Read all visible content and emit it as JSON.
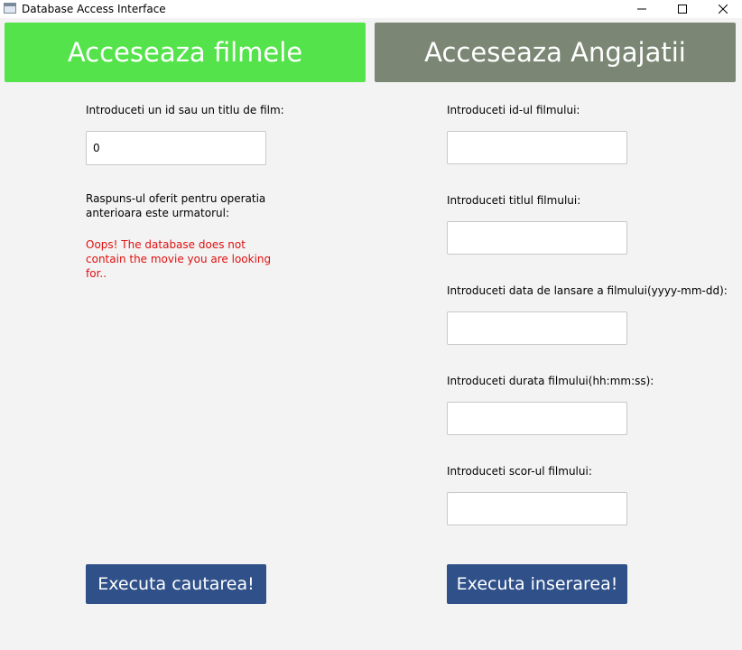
{
  "window": {
    "title": "Database Access Interface"
  },
  "tabs": {
    "films": {
      "label": "Acceseaza filmele",
      "color": "#55e34c"
    },
    "employees": {
      "label": "Acceseaza Angajatii",
      "color": "#7b8774"
    }
  },
  "search": {
    "prompt": "Introduceti un id sau un titlu de film:",
    "value": "0",
    "response_label": "Raspuns-ul oferit pentru operatia anterioara este urmatorul:",
    "response_text": "Oops! The database does not contain the movie you are looking for..",
    "response_color": "#e01010",
    "button_label": "Executa cautarea!"
  },
  "insert": {
    "id_label": "Introduceti id-ul filmului:",
    "id_value": "",
    "title_label": "Introduceti titlul filmului:",
    "title_value": "",
    "date_label": "Introduceti data de lansare a filmului(yyyy-mm-dd):",
    "date_value": "",
    "duration_label": "Introduceti durata filmului(hh:mm:ss):",
    "duration_value": "",
    "score_label": "Introduceti scor-ul filmului:",
    "score_value": "",
    "button_label": "Executa inserarea!"
  },
  "colors": {
    "button": "#2f5089",
    "background": "#f3f3f3"
  }
}
